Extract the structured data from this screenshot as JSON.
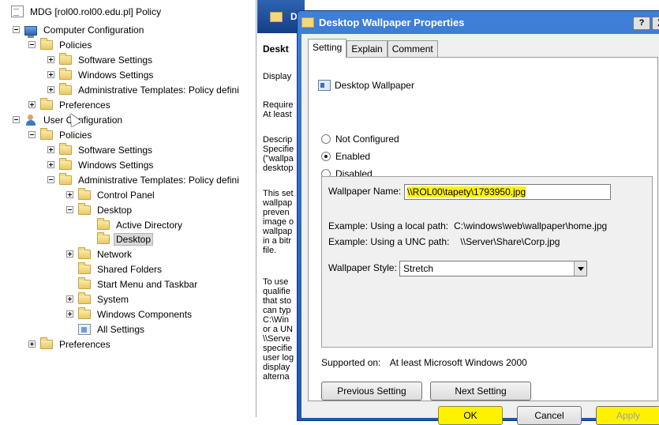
{
  "tree": {
    "items": [
      {
        "label": "MDG [rol00.rol00.edu.pl] Policy",
        "icon": "policy-doc-icon"
      },
      {
        "label": "Computer Configuration",
        "icon": "computer-icon"
      },
      {
        "label": "Policies",
        "icon": "folder-icon"
      },
      {
        "label": "Software Settings",
        "icon": "folder-icon"
      },
      {
        "label": "Windows Settings",
        "icon": "folder-icon"
      },
      {
        "label": "Administrative Templates: Policy defini",
        "icon": "folder-icon"
      },
      {
        "label": "Preferences",
        "icon": "folder-icon"
      },
      {
        "label": "User Configuration",
        "icon": "user-icon"
      },
      {
        "label": "Policies",
        "icon": "folder-icon"
      },
      {
        "label": "Software Settings",
        "icon": "folder-icon"
      },
      {
        "label": "Windows Settings",
        "icon": "folder-icon"
      },
      {
        "label": "Administrative Templates: Policy defini",
        "icon": "folder-icon"
      },
      {
        "label": "Control Panel",
        "icon": "folder-icon"
      },
      {
        "label": "Desktop",
        "icon": "folder-icon"
      },
      {
        "label": "Active Directory",
        "icon": "folder-icon"
      },
      {
        "label": "Desktop",
        "icon": "folder-icon"
      },
      {
        "label": "Network",
        "icon": "folder-icon"
      },
      {
        "label": "Shared Folders",
        "icon": "folder-icon"
      },
      {
        "label": "Start Menu and Taskbar",
        "icon": "folder-icon"
      },
      {
        "label": "System",
        "icon": "folder-icon"
      },
      {
        "label": "Windows Components",
        "icon": "folder-icon"
      },
      {
        "label": "All Settings",
        "icon": "all-settings-icon"
      },
      {
        "label": "Preferences",
        "icon": "folder-icon"
      }
    ]
  },
  "middle": {
    "header_letter": "D",
    "heading": "Deskt",
    "lines": [
      "Display",
      "Require",
      "At least",
      "Descrip",
      "Specifie",
      "(\"wallpa",
      "desktop",
      "This set",
      "wallpap",
      "preven",
      "image o",
      "wallpap",
      "in a bitr",
      "file.",
      "To use",
      "qualifie",
      "that sto",
      "can typ",
      "C:\\Win",
      "or a UN",
      "\\\\Serve",
      "specifie",
      "user log",
      "display",
      "alterna"
    ]
  },
  "dialog": {
    "title": "Desktop Wallpaper Properties",
    "help_label": "?",
    "close_label": "X",
    "tabs": [
      "Setting",
      "Explain",
      "Comment"
    ],
    "policy_name": "Desktop Wallpaper",
    "radios": [
      {
        "label": "Not Configured",
        "checked": false
      },
      {
        "label": "Enabled",
        "checked": true
      },
      {
        "label": "Disabled",
        "checked": false
      }
    ],
    "wallpaper_name_label": "Wallpaper Name:",
    "wallpaper_name_value": "\\\\ROL00\\tapety\\1793950.jpg",
    "example_local_label": "Example: Using a local path:",
    "example_local_value": "C:\\windows\\web\\wallpaper\\home.jpg",
    "example_unc_label": "Example: Using a UNC path:",
    "example_unc_value": "\\\\Server\\Share\\Corp.jpg",
    "wallpaper_style_label": "Wallpaper Style:",
    "wallpaper_style_value": "Stretch",
    "supported_label": "Supported on:",
    "supported_value": "At least Microsoft Windows 2000",
    "previous_setting": "Previous Setting",
    "next_setting": "Next Setting",
    "ok": "OK",
    "cancel": "Cancel",
    "apply": "Apply"
  },
  "colors": {
    "highlight": "#fff200",
    "titlebar": "#1c57b2"
  }
}
